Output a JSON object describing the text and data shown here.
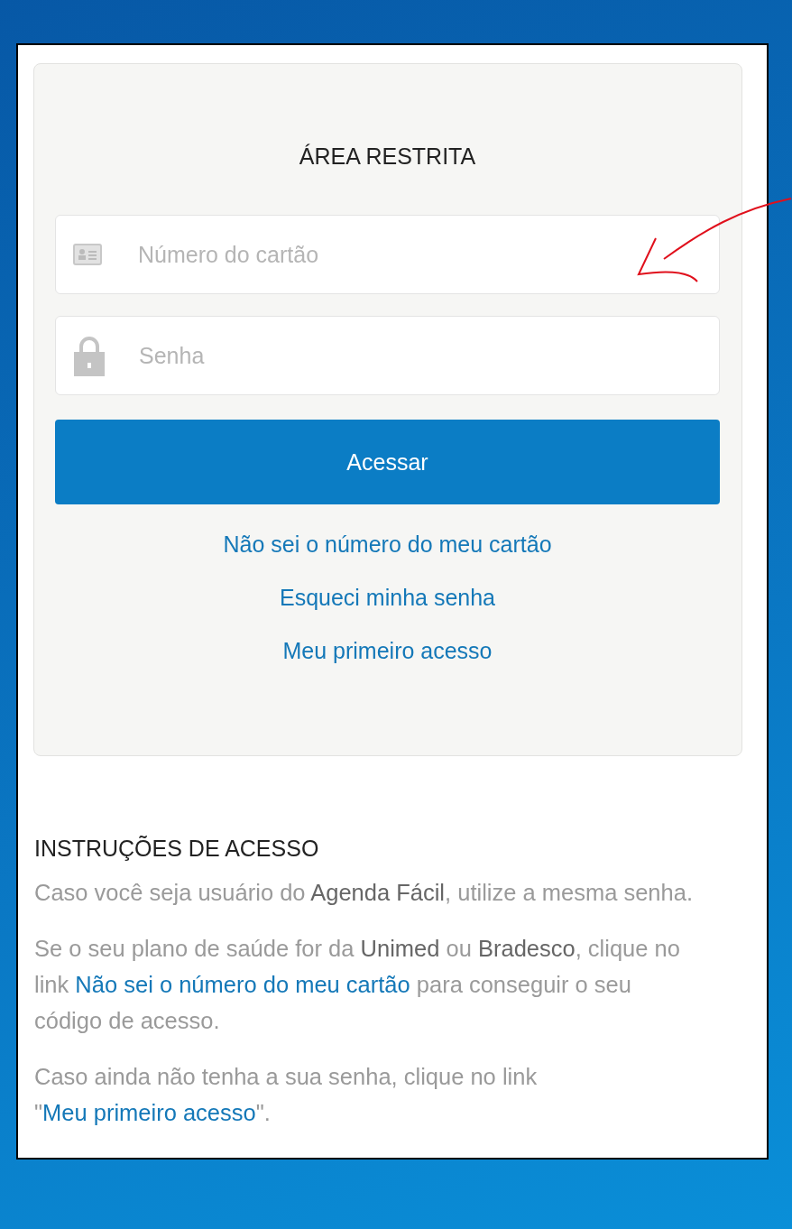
{
  "login": {
    "title": "ÁREA RESTRITA",
    "fields": [
      {
        "kind": "card",
        "placeholder": "Número do cartão"
      },
      {
        "kind": "lock",
        "placeholder": "Senha"
      }
    ],
    "submit": "Acessar",
    "links": [
      "Não sei o número do meu cartão",
      "Esqueci minha senha",
      "Meu primeiro acesso"
    ]
  },
  "instructions": {
    "title": "INSTRUÇÕES DE ACESSO",
    "paragraphs": [
      [
        {
          "kind": "text",
          "text": "Caso você seja usuário do "
        },
        {
          "kind": "bold",
          "text": "Agenda Fácil"
        },
        {
          "kind": "text",
          "text": ", utilize a mesma senha."
        }
      ],
      [
        {
          "kind": "text",
          "text": "Se o seu plano de saúde for da "
        },
        {
          "kind": "bold",
          "text": "Unimed"
        },
        {
          "kind": "text",
          "text": " ou "
        },
        {
          "kind": "bold",
          "text": "Bradesco"
        },
        {
          "kind": "text",
          "text": ", clique no link "
        },
        {
          "kind": "link",
          "text": "Não sei o número do meu cartão"
        },
        {
          "kind": "text",
          "text": " para conseguir o seu código de acesso."
        }
      ],
      [
        {
          "kind": "text",
          "text": "Caso ainda não tenha a sua senha, clique no link \""
        },
        {
          "kind": "link",
          "text": "Meu primeiro acesso"
        },
        {
          "kind": "text",
          "text": "\"."
        }
      ]
    ]
  }
}
